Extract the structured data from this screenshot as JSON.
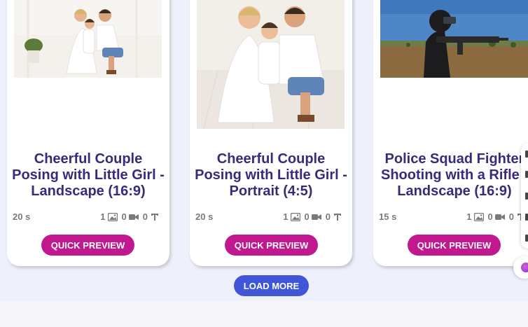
{
  "cards": [
    {
      "title_lines": [
        "Cheerful Couple",
        "Posing with Little Girl -",
        "Landscape (16:9)"
      ],
      "duration": "20 s",
      "images": "1",
      "videos": "0",
      "texts": "0",
      "button": "QUICK PREVIEW",
      "thumbnail": "family-photo-landscape"
    },
    {
      "title_lines": [
        "Cheerful Couple",
        "Posing with Little Girl -",
        "Portrait (4:5)"
      ],
      "duration": "20 s",
      "images": "1",
      "videos": "0",
      "texts": "0",
      "button": "QUICK PREVIEW",
      "thumbnail": "family-photo-portrait"
    },
    {
      "title_lines": [
        "Police Squad Fighter",
        "Shooting with a Rifle -",
        "Landscape (16:9)"
      ],
      "duration": "15 s",
      "images": "1",
      "videos": "0",
      "texts": "0",
      "button": "QUICK PREVIEW",
      "thumbnail": "police-fighter-photo"
    }
  ],
  "load_more": "LOAD MORE",
  "icons": [
    "image-icon",
    "video-camera-icon",
    "text-icon"
  ],
  "colors": {
    "title": "#3b2a7a",
    "preview_button": "#c2188f",
    "load_more_button": "#4056d9",
    "page_band": "#eef1fb"
  }
}
